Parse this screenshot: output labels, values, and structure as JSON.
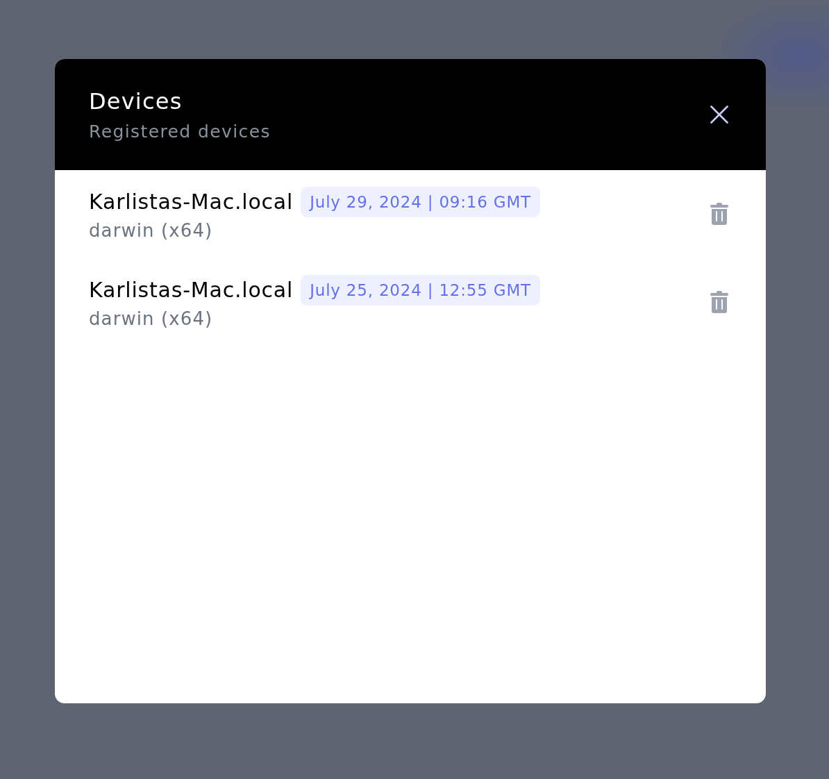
{
  "dialog": {
    "title": "Devices",
    "subtitle": "Registered devices"
  },
  "devices": [
    {
      "name": "Karlistas-Mac.local",
      "timestamp": "July 29, 2024 | 09:16 GMT",
      "platform": "darwin (x64)"
    },
    {
      "name": "Karlistas-Mac.local",
      "timestamp": "July 25, 2024 | 12:55 GMT",
      "platform": "darwin (x64)"
    }
  ]
}
